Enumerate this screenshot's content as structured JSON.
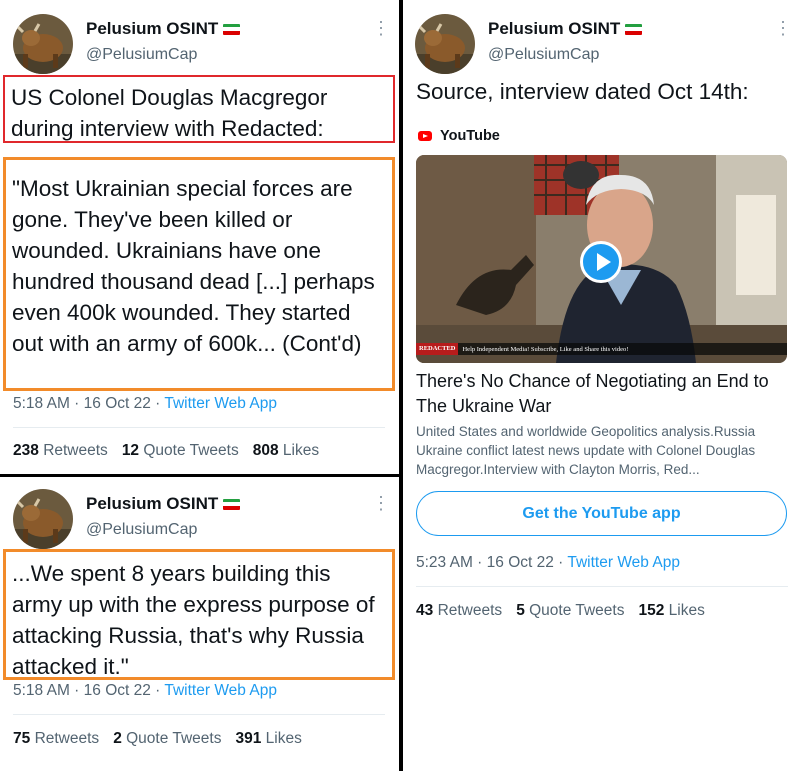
{
  "account": {
    "display_name": "Pelusium OSINT",
    "handle": "@PelusiumCap"
  },
  "tweet1": {
    "headline": "US Colonel Douglas Macgregor during interview with Redacted:",
    "quote": "\"Most Ukrainian special forces are gone. They've been killed or wounded. Ukrainians have one hundred thousand dead [...] perhaps even 400k wounded. They started out with an army of 600k...  (Cont'd)",
    "time": "5:18 AM",
    "date": "16 Oct 22",
    "app": "Twitter Web App",
    "stats": {
      "retweets": "238",
      "retweets_label": "Retweets",
      "quotes": "12",
      "quotes_label": "Quote Tweets",
      "likes": "808",
      "likes_label": "Likes"
    }
  },
  "tweet2": {
    "quote": "...We spent 8 years building this army up with the express purpose of attacking Russia, that's why Russia attacked it.\"",
    "time": "5:18 AM",
    "date": "16 Oct 22",
    "app": "Twitter Web App",
    "stats": {
      "retweets": "75",
      "retweets_label": "Retweets",
      "quotes": "2",
      "quotes_label": "Quote Tweets",
      "likes": "391",
      "likes_label": "Likes"
    }
  },
  "tweet3": {
    "text": "Source, interview dated Oct 14th:",
    "card": {
      "source": "YouTube",
      "banner_brand": "REDACTED",
      "banner_text": "Help Independent Media! Subscribe, Like and Share this video!",
      "title": "There's No Chance of Negotiating an End to The Ukraine War",
      "description": "United States and worldwide Geopolitics analysis.Russia Ukraine conflict latest news update with Colonel Douglas Macgregor.Interview with Clayton Morris, Red...",
      "button": "Get the YouTube app"
    },
    "time": "5:23 AM",
    "date": "16 Oct 22",
    "app": "Twitter Web App",
    "stats": {
      "retweets": "43",
      "retweets_label": "Retweets",
      "quotes": "5",
      "quotes_label": "Quote Tweets",
      "likes": "152",
      "likes_label": "Likes"
    }
  },
  "colors": {
    "link": "#1d9bf0",
    "red_box": "#e0282c",
    "orange_box": "#f28b2a",
    "youtube": "#ff0000"
  },
  "icons": [
    "more-options-icon",
    "iran-flag-icon",
    "youtube-logo-icon",
    "play-icon",
    "avatar-icon"
  ]
}
